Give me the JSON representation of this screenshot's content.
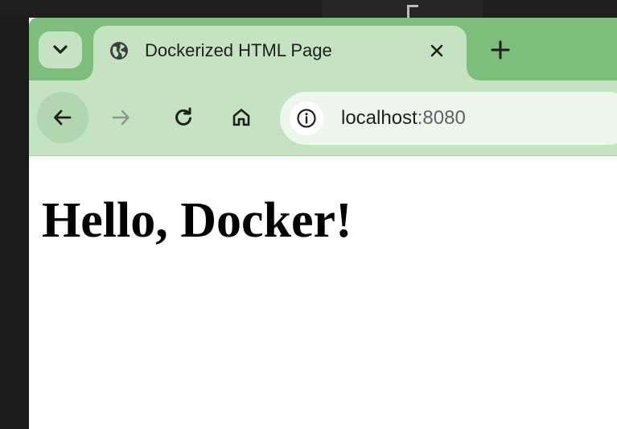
{
  "browser": {
    "tab": {
      "title": "Dockerized HTML Page",
      "favicon": "globe-icon",
      "close_glyph": "✕"
    },
    "new_tab_glyph": "+",
    "tab_search_icon": "chevron-down-icon",
    "toolbar": {
      "back_icon": "arrow-left-icon",
      "forward_icon": "arrow-right-icon",
      "reload_icon": "reload-icon",
      "home_icon": "home-icon",
      "site_info_icon": "info-icon"
    },
    "address": {
      "host": "localhost",
      "port": ":8080"
    }
  },
  "page": {
    "heading": "Hello, Docker!"
  },
  "colors": {
    "tabstrip": "#7dbe7d",
    "toolbar": "#c5e3c3",
    "omnibox": "#eef6ee",
    "desktop_background": "#1b1b1b"
  }
}
